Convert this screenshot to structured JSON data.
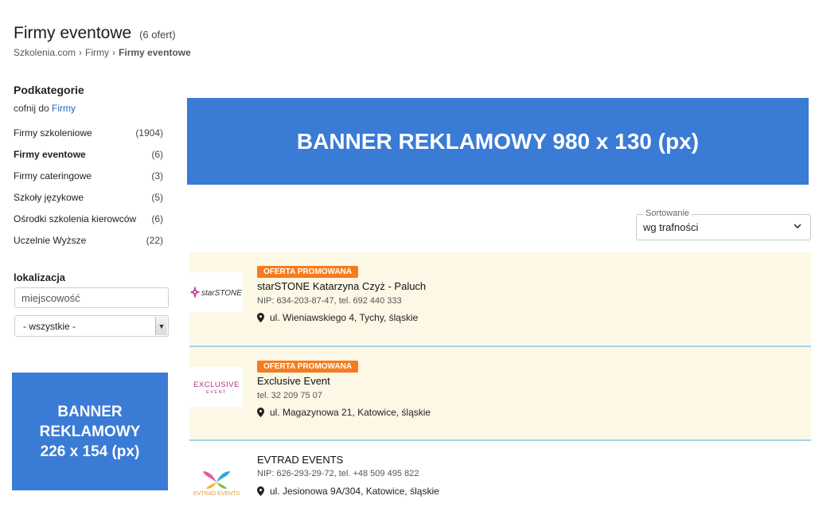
{
  "header": {
    "title": "Firmy eventowe",
    "count": "(6 ofert)",
    "breadcrumb": [
      {
        "label": "Szkolenia.com"
      },
      {
        "label": "Firmy"
      },
      {
        "label": "Firmy eventowe"
      }
    ],
    "breadcrumb_sep": "›"
  },
  "sidebar": {
    "subcategories_title": "Podkategorie",
    "back_text": "cofnij do",
    "back_link": "Firmy",
    "categories": [
      {
        "label": "Firmy szkoleniowe",
        "count": "(1904)"
      },
      {
        "label": "Firmy eventowe",
        "count": "(6)"
      },
      {
        "label": "Firmy cateringowe",
        "count": "(3)"
      },
      {
        "label": "Szkoły językowe",
        "count": "(5)"
      },
      {
        "label": "Ośrodki szkolenia kierowców",
        "count": "(6)"
      },
      {
        "label": "Uczelnie Wyższe",
        "count": "(22)"
      }
    ],
    "location_title": "lokalizacja",
    "city_placeholder": "miejscowość",
    "region_value": "- wszystkie -",
    "banner": [
      "BANNER",
      "REKLAMOWY",
      "226 x 154 (px)"
    ]
  },
  "top_banner": "BANNER REKLAMOWY 980 x 130 (px)",
  "sort": {
    "label": "Sortowanie",
    "value": "wg trafności"
  },
  "listings": [
    {
      "badge": "OFERTA PROMOWANA",
      "name": "starSTONE Katarzyna Czyż - Paluch",
      "info": "NIP: 634-203-87-47, tel. 692 440 333",
      "address": "ul. Wieniawskiego 4, Tychy, śląskie",
      "logo_text": "starSTONE"
    },
    {
      "badge": "OFERTA PROMOWANA",
      "name": "Exclusive Event",
      "info": "tel. 32 209 75 07",
      "address": "ul. Magazynowa 21, Katowice, śląskie",
      "logo_text": "EXCLUSIVE",
      "logo_sub": "EVENT"
    },
    {
      "name": "EVTRAD EVENTS",
      "info": "NIP: 626-293-29-72, tel. +48 509 495 822",
      "address": "ul. Jesionowa 9A/304, Katowice, śląskie",
      "logo_text": "EVTRAD EVENTS"
    }
  ],
  "colors": {
    "banner": "#3a7bd5",
    "badge": "#f57c1f",
    "promo_bg": "#fdf7e6",
    "link": "#2a64c4"
  }
}
